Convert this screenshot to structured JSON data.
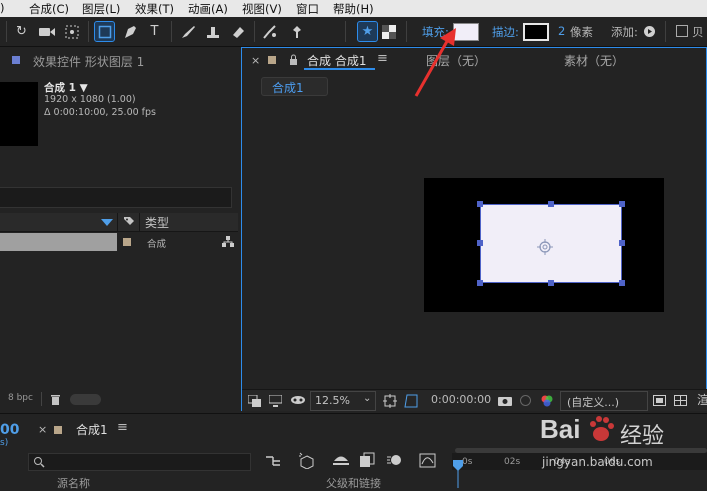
{
  "menu": [
    "合成(C)",
    "图层(L)",
    "效果(T)",
    "动画(A)",
    "视图(V)",
    "窗口",
    "帮助(H)"
  ],
  "toolbar": {
    "fill_label": "填充:",
    "stroke_label": "描边:",
    "stroke_width": "2",
    "stroke_unit": "像素",
    "add_label": "添加:",
    "cut_label": "贝",
    "fill_color": "#f1eef8",
    "accent": "#2d8ceb"
  },
  "project": {
    "header": "效果控件 形状图层 1",
    "comp_name": "合成 1 ▼",
    "comp_size": "1920 x 1080 (1.00)",
    "comp_duration": "Δ 0:00:10:00, 25.00 fps",
    "col_type": "类型",
    "row_type": "合成",
    "bpc": "8 bpc"
  },
  "viewer": {
    "tab": "合成 合成1",
    "layer_tab": "图层（无）",
    "footage_tab": "素材（无）",
    "breadcrumb": "合成1",
    "zoom": "12.5%",
    "timecode": "0:00:00:00",
    "view_mode": "(自定义...)",
    "shape_fill": "#f1eef8",
    "selection_color": "#4f63c8"
  },
  "timeline": {
    "tab": "合成1",
    "time": "00",
    "time2": "s)",
    "col_source": "源名称",
    "col_parent": "父级和链接",
    "ruler": [
      "0s",
      "02s",
      "04s",
      "06s"
    ]
  },
  "watermark": {
    "url": "jingyan.baidu.com",
    "brand": "Bai",
    "brand2": "经验"
  },
  "annotation_color": "#e8312e"
}
